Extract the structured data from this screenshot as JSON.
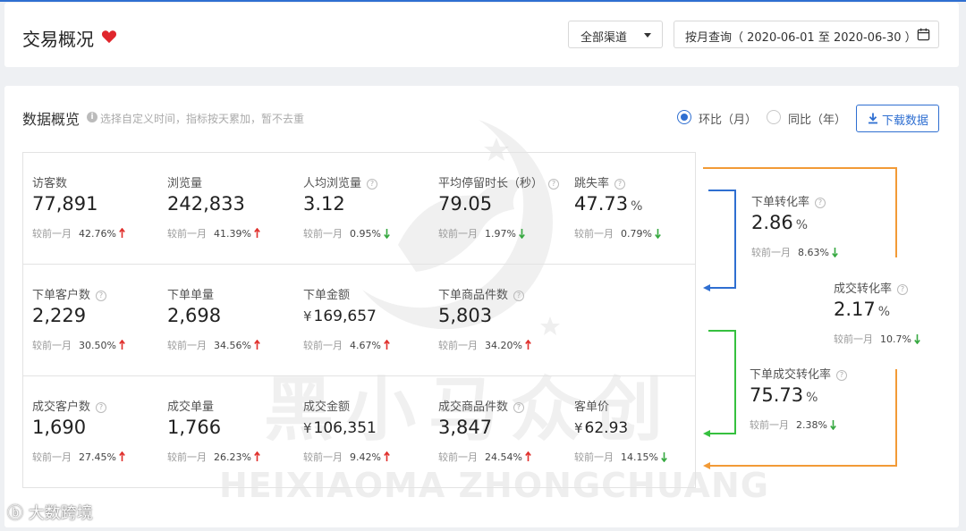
{
  "header": {
    "title": "交易概况",
    "channel": "全部渠道",
    "date_range": "按月查询（ 2020-06-01 至 2020-06-30 ）"
  },
  "overview": {
    "title": "数据概览",
    "hint": "选择自定义时间，指标按天累加，暂不去重",
    "radio_mom": "环比（月）",
    "radio_yoy": "同比（年）",
    "download": "下载数据",
    "compare_label": "较前一月",
    "rows": [
      [
        {
          "label": "访客数",
          "help": false,
          "value": "77,891",
          "unit": "",
          "currency": "",
          "change": "42.76%",
          "trend": "up"
        },
        {
          "label": "浏览量",
          "help": false,
          "value": "242,833",
          "unit": "",
          "currency": "",
          "change": "41.39%",
          "trend": "up"
        },
        {
          "label": "人均浏览量",
          "help": true,
          "value": "3.12",
          "unit": "",
          "currency": "",
          "change": "0.95%",
          "trend": "down"
        },
        {
          "label": "平均停留时长（秒）",
          "help": true,
          "value": "79.05",
          "unit": "",
          "currency": "",
          "change": "1.97%",
          "trend": "down"
        },
        {
          "label": "跳失率",
          "help": true,
          "value": "47.73",
          "unit": "%",
          "currency": "",
          "change": "0.79%",
          "trend": "down"
        }
      ],
      [
        {
          "label": "下单客户数",
          "help": true,
          "value": "2,229",
          "unit": "",
          "currency": "",
          "change": "30.50%",
          "trend": "up"
        },
        {
          "label": "下单单量",
          "help": false,
          "value": "2,698",
          "unit": "",
          "currency": "",
          "change": "34.56%",
          "trend": "up"
        },
        {
          "label": "下单金额",
          "help": false,
          "value": "169,657",
          "unit": "",
          "currency": "¥",
          "change": "4.67%",
          "trend": "up"
        },
        {
          "label": "下单商品件数",
          "help": true,
          "value": "5,803",
          "unit": "",
          "currency": "",
          "change": "34.20%",
          "trend": "up"
        }
      ],
      [
        {
          "label": "成交客户数",
          "help": true,
          "value": "1,690",
          "unit": "",
          "currency": "",
          "change": "27.45%",
          "trend": "up"
        },
        {
          "label": "成交单量",
          "help": false,
          "value": "1,766",
          "unit": "",
          "currency": "",
          "change": "26.23%",
          "trend": "up"
        },
        {
          "label": "成交金额",
          "help": false,
          "value": "106,351",
          "unit": "",
          "currency": "¥",
          "change": "9.42%",
          "trend": "up"
        },
        {
          "label": "成交商品件数",
          "help": true,
          "value": "3,847",
          "unit": "",
          "currency": "",
          "change": "24.54%",
          "trend": "up"
        },
        {
          "label": "客单价",
          "help": false,
          "value": "62.93",
          "unit": "",
          "currency": "¥",
          "change": "14.15%",
          "trend": "down"
        }
      ]
    ],
    "conversions": [
      {
        "label": "下单转化率",
        "value": "2.86",
        "unit": "%",
        "change": "8.63%",
        "trend": "down"
      },
      {
        "label": "成交转化率",
        "value": "2.17",
        "unit": "%",
        "change": "10.7%",
        "trend": "down"
      },
      {
        "label": "下单成交转化率",
        "value": "75.73",
        "unit": "%",
        "change": "2.38%",
        "trend": "down"
      }
    ]
  },
  "watermark": {
    "cn": "黑小马众创",
    "en": "HEIXIAOMA ZHONGCHUANG",
    "corner": "大数跨境"
  },
  "colors": {
    "accent": "#2f6fd1",
    "up": "#e0302c",
    "down": "#36a840",
    "flow_blue": "#2f6fd1",
    "flow_green": "#36c03f",
    "flow_orange": "#f29a36",
    "heart": "#e0262c"
  }
}
